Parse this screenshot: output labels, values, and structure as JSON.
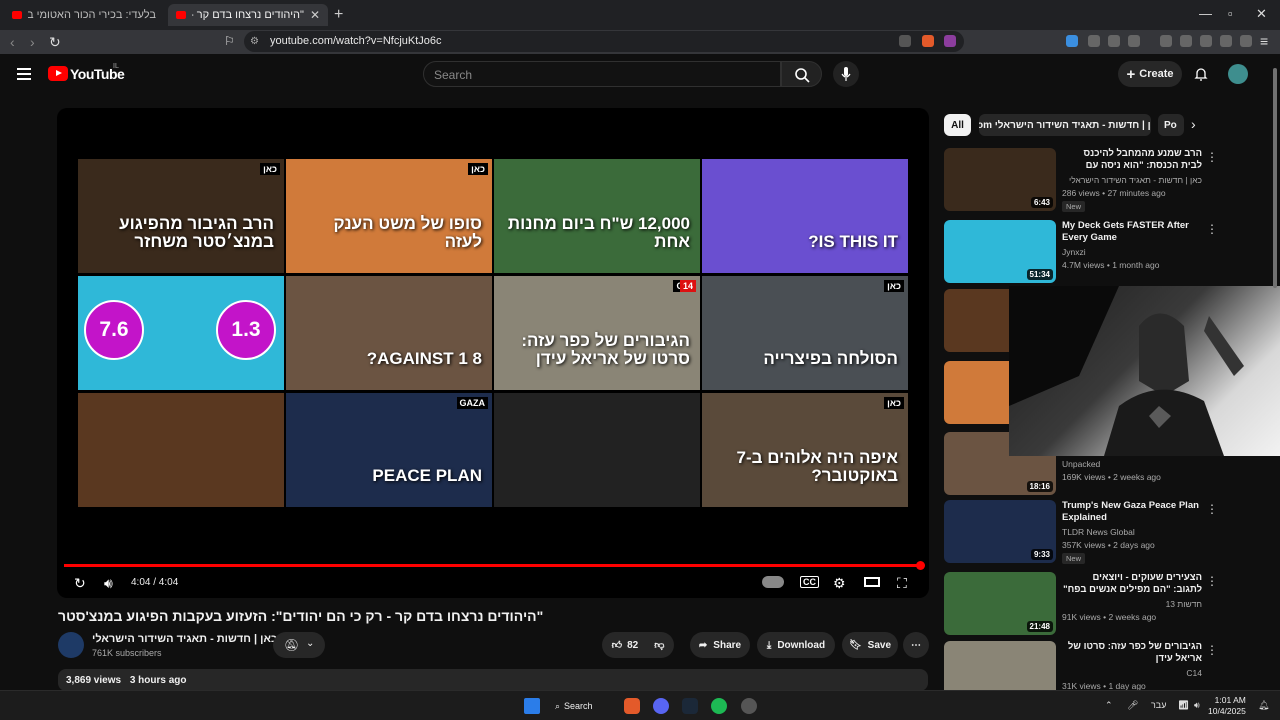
{
  "browser": {
    "tabs": [
      {
        "title": "בלעדי: בכירי הכור האטומי בדימונה מט",
        "active": false
      },
      {
        "title": "\"היהודים נרצחו בדם קר - רק כי הם יהודים\"",
        "active": true
      }
    ],
    "url": "youtube.com/watch?v=NfcjuKtJo6c",
    "new_tab": "+",
    "close": "✕"
  },
  "header": {
    "logo_text": "YouTube",
    "country": "IL",
    "search_placeholder": "Search",
    "create_label": "Create"
  },
  "player": {
    "time": "4:04 / 4:04",
    "progress_fraction": 1.0,
    "endscreen": [
      {
        "caption": "הרב הגיבור מהפיגוע במנצ׳סטר משחזר",
        "badge": "כאן",
        "bg": "#3a2a1c"
      },
      {
        "caption": "סופו של משט הענק לעזה",
        "badge": "כאן",
        "bg": "#d07a3a"
      },
      {
        "caption": "12,000 ש\"ח ביום מחנות אחת",
        "badge": "",
        "bg": "#3b6b3a"
      },
      {
        "caption": "IS THIS IT?",
        "badge": "",
        "bg": "#6a4fd0"
      },
      {
        "caption": "",
        "badge": "",
        "bg": "#2fb8d8"
      },
      {
        "caption": "8 AGAINST 1?",
        "badge": "",
        "bg": "#6b5442"
      },
      {
        "caption": "הגיבורים של כפר עזה: סרטו של אריאל עידן",
        "badge": "C14",
        "bg": "#8a8576"
      },
      {
        "caption": "הסולחה בפיצרייה",
        "badge": "כאן",
        "bg": "#4a4f54"
      },
      {
        "caption": "",
        "badge": "",
        "bg": "#5a3820"
      },
      {
        "caption": "PEACE PLAN",
        "badge": "GAZA",
        "bg": "#1d2c4c"
      },
      {
        "caption": "",
        "badge": "",
        "bg": "#222"
      },
      {
        "caption": "איפה היה אלוהים ב-7 באוקטובר?",
        "badge": "כאן",
        "bg": "#5a4a3a"
      }
    ],
    "bubbles": [
      "7.6",
      "1.3"
    ],
    "tv_badge": "14"
  },
  "video": {
    "title": "\"היהודים נרצחו בדם קר - רק כי הם יהודים\": הזעזוע בעקבות הפיגוע במנצ'סטר",
    "channel": "כאן | חדשות - תאגיד השידור הישראלי",
    "subscribers": "761K subscribers",
    "likes": "82",
    "share_label": "Share",
    "download_label": "Download",
    "save_label": "Save",
    "views": "3,869 views",
    "age": "3 hours ago"
  },
  "sidebar": {
    "chips": [
      "All",
      "From כאן | חדשות - תאגיד השידור הישראלי",
      "Po"
    ],
    "items": [
      {
        "title": "הרב שמנע מהמחבל להיכנס לבית הכנסת: \"הוא ניסה עם הסכין, החזקנ",
        "channel": "כאן | חדשות - תאגיד השידור הישראלי",
        "meta": "286 views • 27 minutes ago",
        "duration": "6:43",
        "new": "New",
        "rtl": true,
        "thumb": "#3a2a1c"
      },
      {
        "title": "My Deck Gets FASTER After Every Game",
        "channel": "Jynxzi",
        "meta": "4.7M views • 1 month ago",
        "duration": "51:34",
        "new": "",
        "rtl": false,
        "thumb": "#2fb8d8"
      },
      {
        "title": "",
        "channel": "",
        "meta": "",
        "duration": "",
        "new": "",
        "rtl": false,
        "thumb": "#5a3820"
      },
      {
        "title": "",
        "channel": "",
        "meta": "",
        "duration": "",
        "new": "",
        "rtl": false,
        "thumb": "#d07a3a"
      },
      {
        "title": "",
        "channel": "Unpacked",
        "meta": "169K views • 2 weeks ago",
        "duration": "18:16",
        "new": "",
        "rtl": false,
        "thumb": "#6b5442"
      },
      {
        "title": "Trump's New Gaza Peace Plan Explained",
        "channel": "TLDR News Global",
        "meta": "357K views • 2 days ago",
        "duration": "9:33",
        "new": "New",
        "rtl": false,
        "thumb": "#1d2c4c"
      },
      {
        "title": "הצעירים שעוקים - ויוצאים לתגוב: \"הם מפילים אנשים בפח\"",
        "channel": "חדשות 13",
        "meta": "91K views • 2 weeks ago",
        "duration": "21:48",
        "new": "",
        "rtl": true,
        "thumb": "#3b6b3a"
      },
      {
        "title": "הגיבורים של כפר עזה: סרטו של אריאל עידן",
        "channel": "C14",
        "meta": "31K views • 1 day ago",
        "duration": "",
        "new": "",
        "rtl": true,
        "thumb": "#8a8576"
      }
    ]
  },
  "taskbar": {
    "search_label": "Search",
    "lang": "עבר",
    "time": "1:01 AM",
    "date": "10/4/2025"
  },
  "colors": {
    "accent": "#ff0000",
    "bg": "#0f0f0f",
    "chip": "#272727"
  }
}
